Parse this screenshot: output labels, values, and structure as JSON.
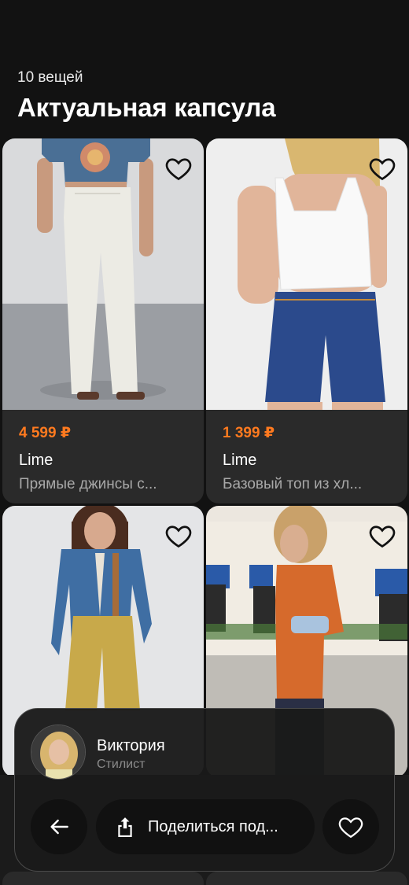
{
  "header": {
    "count": "10 вещей",
    "title": "Актуальная капсула"
  },
  "products": [
    {
      "price": "4 599 ₽",
      "brand": "Lime",
      "description": "Прямые джинсы с..."
    },
    {
      "price": "1 399 ₽",
      "brand": "Lime",
      "description": "Базовый топ из хл..."
    },
    {
      "price": "",
      "brand": "",
      "description": ""
    },
    {
      "price": "",
      "brand": "",
      "description": ""
    }
  ],
  "stylist": {
    "name": "Виктория",
    "role": "Стилист"
  },
  "actions": {
    "share_label": "Поделиться под...",
    "back_icon": "arrow-left-icon",
    "share_icon": "share-icon",
    "like_icon": "heart-icon"
  },
  "colors": {
    "price": "#ff7a1f",
    "background": "#121212",
    "card": "#2a2a2a"
  }
}
